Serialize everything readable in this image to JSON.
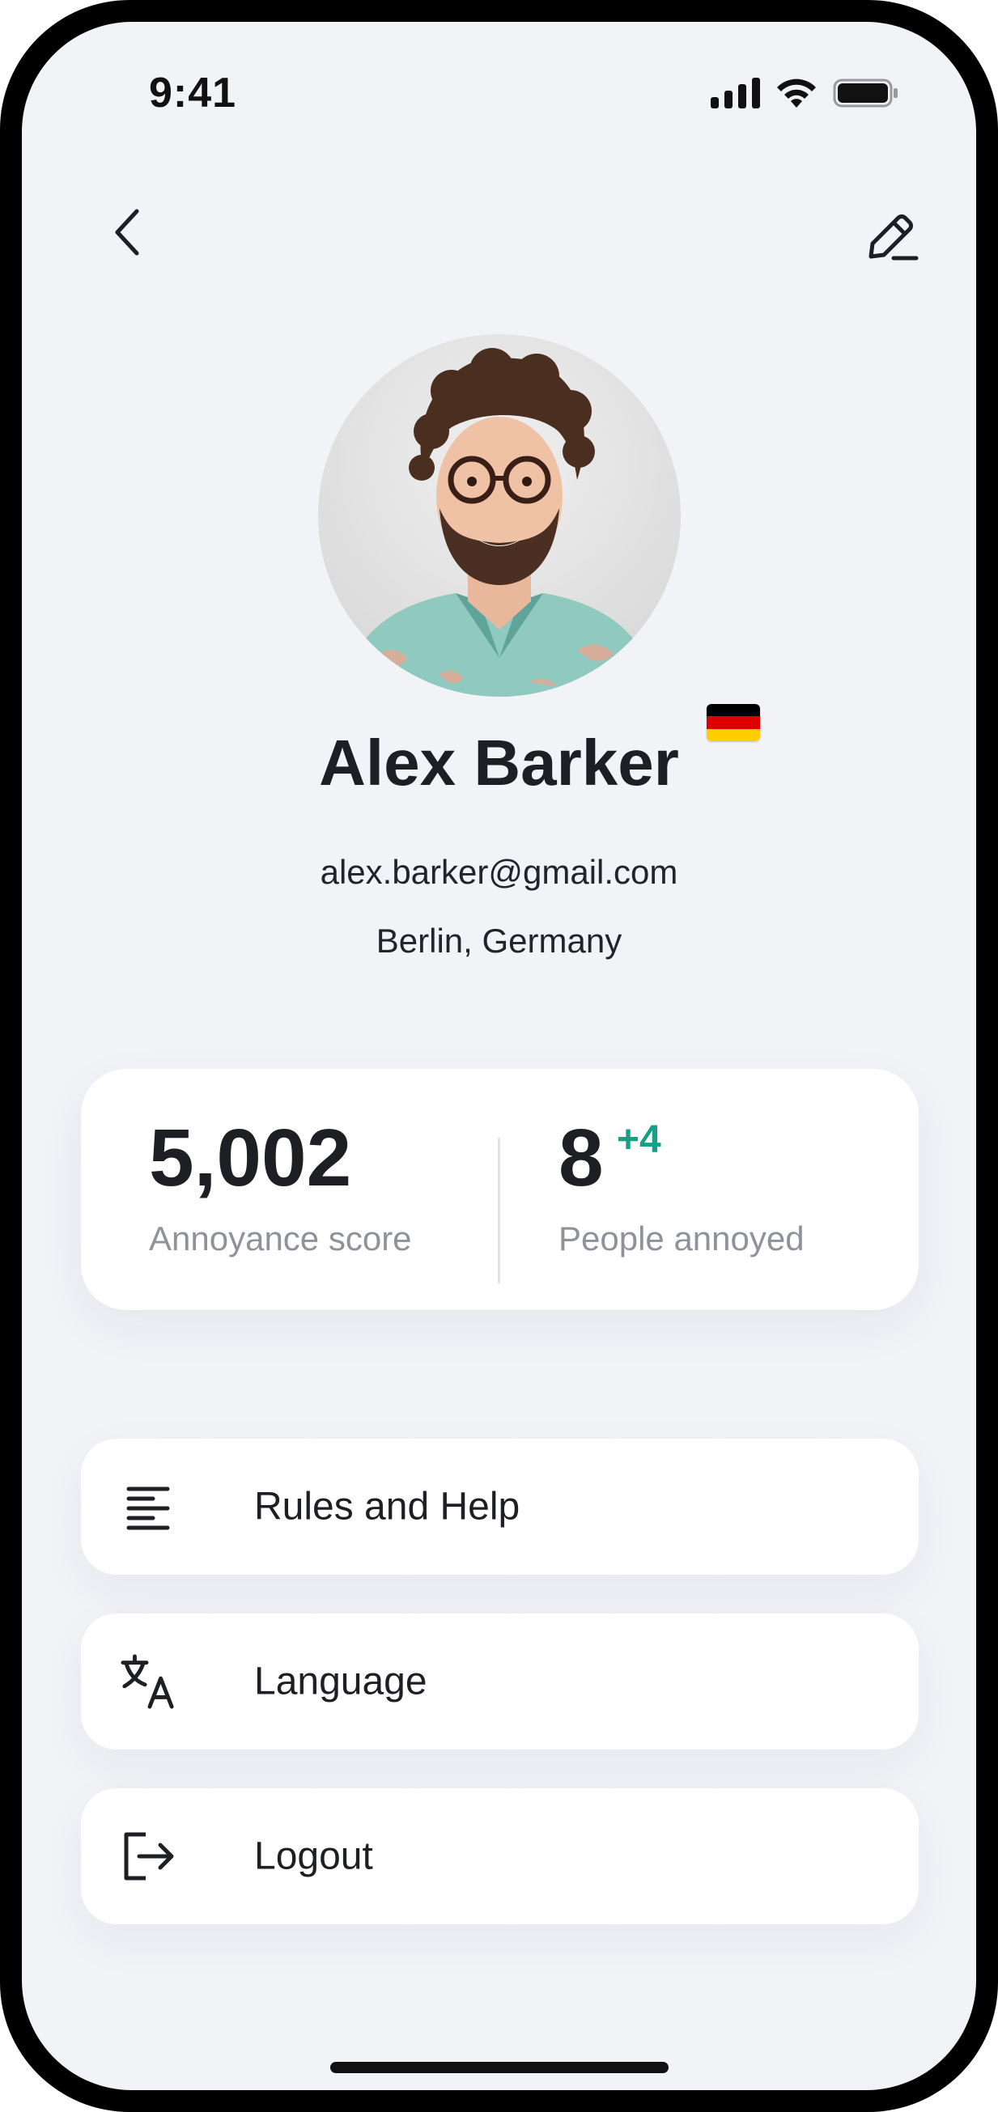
{
  "status_bar": {
    "time": "9:41",
    "icons": [
      "signal-icon",
      "wifi-icon",
      "battery-icon"
    ]
  },
  "header": {
    "back_icon": "chevron-left-icon",
    "edit_icon": "pencil-icon"
  },
  "profile": {
    "name": "Alex Barker",
    "email": "alex.barker@gmail.com",
    "location": "Berlin, Germany",
    "flag": "german-flag-icon",
    "flag_colors": [
      "#000000",
      "#dd0000",
      "#ffce00"
    ]
  },
  "stats": {
    "annoyance_score": "5,002",
    "annoyance_label": "Annoyance score",
    "people_annoyed": "8",
    "people_annoyed_delta": "+4",
    "people_annoyed_label": "People annoyed"
  },
  "menu": {
    "items": [
      {
        "label": "Rules and Help",
        "icon": "text-align-left-icon"
      },
      {
        "label": "Language",
        "icon": "translate-icon"
      },
      {
        "label": "Logout",
        "icon": "logout-icon"
      }
    ]
  },
  "colors": {
    "background": "#f2f3f7",
    "card": "#ffffff",
    "accent_green": "#16a085",
    "muted_text": "#8f919b",
    "primary_text": "#1e1f24"
  }
}
